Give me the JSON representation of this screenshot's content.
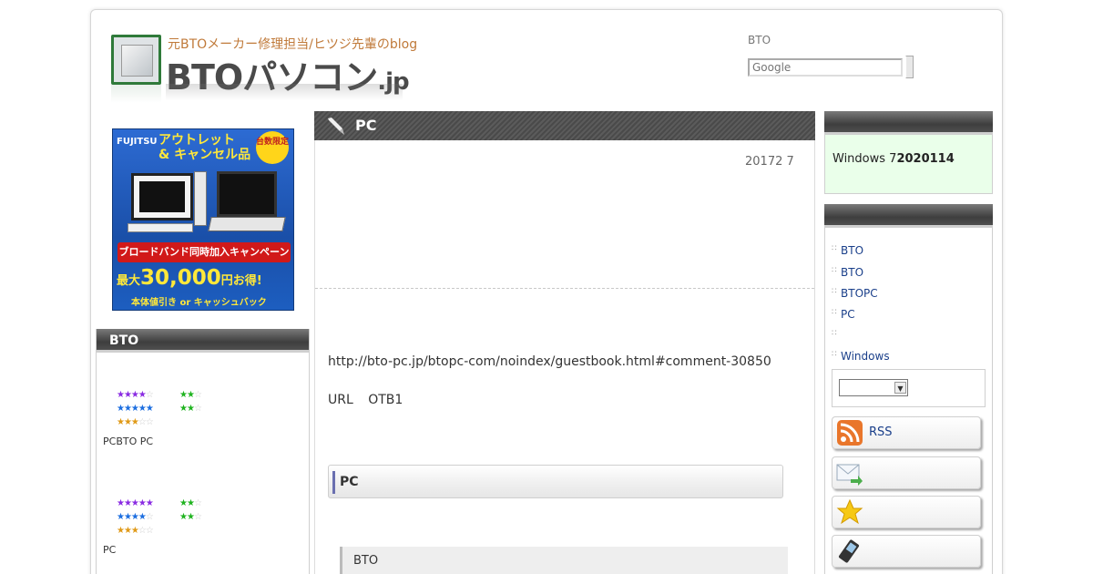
{
  "header": {
    "tagline": "元BTOメーカー修理担当/ヒツジ先輩のblog",
    "logo_main": "BTOパソコン",
    "logo_suffix": ".jp",
    "search_label": "BTO",
    "search_placeholder": "Google"
  },
  "banner": {
    "brand": "FUJITSU",
    "headline_line1": "アウトレット",
    "headline_line2": "& キャンセル品",
    "badge": "台数限定",
    "ribbon": "ブロードバンド同時加入キャンペーン",
    "big_prefix": "最大",
    "big_amount": "30,000",
    "big_suffix": "円お得!",
    "sub": "本体値引き or キャッシュバック"
  },
  "left_widget": {
    "title": "BTO",
    "block1_caption": "PCBTO PC",
    "block2_caption": "PC"
  },
  "main": {
    "title": "PC",
    "date": "20172 7",
    "url": "http://bto-pc.jp/btopc-com/noindex/guestbook.html#comment-30850",
    "line2": "URL OTB1",
    "sub_heading": "PC",
    "quote": "BTO"
  },
  "right": {
    "notice_text": "Windows 7",
    "notice_bold": "2020114",
    "links": [
      "BTO",
      "BTO",
      "BTOPC",
      "PC",
      "",
      "Windows"
    ],
    "buttons": [
      {
        "label": "RSS",
        "icon": "rss-icon"
      },
      {
        "label": "",
        "icon": "mail-icon"
      },
      {
        "label": "",
        "icon": "star-icon"
      },
      {
        "label": "",
        "icon": "mobile-phone-icon"
      }
    ]
  },
  "colors": {
    "bar_dark": "#3e3e3e",
    "tagline": "#c07a3a",
    "link": "#1a3f8a",
    "notice_bg": "#eaffea"
  }
}
